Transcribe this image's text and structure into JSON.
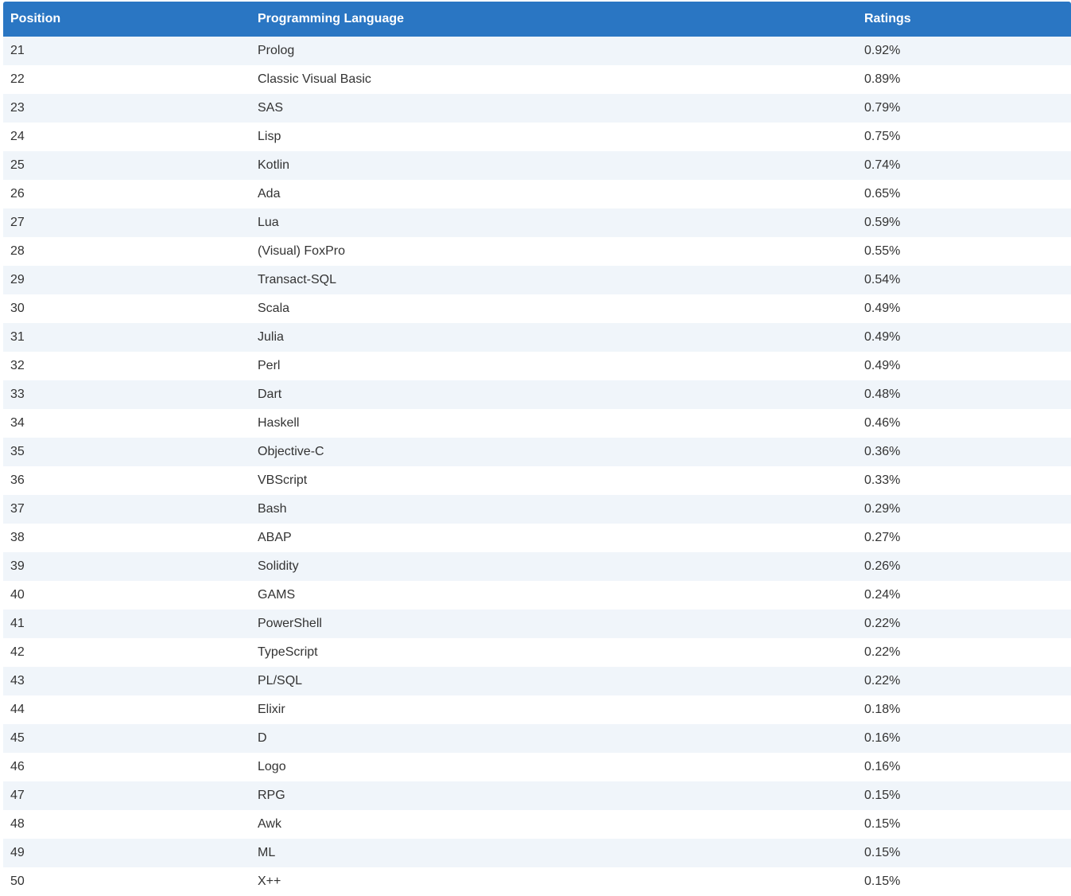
{
  "table": {
    "headers": {
      "position": "Position",
      "language": "Programming Language",
      "ratings": "Ratings"
    },
    "header_color": "#2a76c3",
    "stripe_color": "#f0f5fa",
    "rows": [
      {
        "position": "21",
        "language": "Prolog",
        "rating": "0.92%"
      },
      {
        "position": "22",
        "language": "Classic Visual Basic",
        "rating": "0.89%"
      },
      {
        "position": "23",
        "language": "SAS",
        "rating": "0.79%"
      },
      {
        "position": "24",
        "language": "Lisp",
        "rating": "0.75%"
      },
      {
        "position": "25",
        "language": "Kotlin",
        "rating": "0.74%"
      },
      {
        "position": "26",
        "language": "Ada",
        "rating": "0.65%"
      },
      {
        "position": "27",
        "language": "Lua",
        "rating": "0.59%"
      },
      {
        "position": "28",
        "language": "(Visual) FoxPro",
        "rating": "0.55%"
      },
      {
        "position": "29",
        "language": "Transact-SQL",
        "rating": "0.54%"
      },
      {
        "position": "30",
        "language": "Scala",
        "rating": "0.49%"
      },
      {
        "position": "31",
        "language": "Julia",
        "rating": "0.49%"
      },
      {
        "position": "32",
        "language": "Perl",
        "rating": "0.49%"
      },
      {
        "position": "33",
        "language": "Dart",
        "rating": "0.48%"
      },
      {
        "position": "34",
        "language": "Haskell",
        "rating": "0.46%"
      },
      {
        "position": "35",
        "language": "Objective-C",
        "rating": "0.36%"
      },
      {
        "position": "36",
        "language": "VBScript",
        "rating": "0.33%"
      },
      {
        "position": "37",
        "language": "Bash",
        "rating": "0.29%"
      },
      {
        "position": "38",
        "language": "ABAP",
        "rating": "0.27%"
      },
      {
        "position": "39",
        "language": "Solidity",
        "rating": "0.26%"
      },
      {
        "position": "40",
        "language": "GAMS",
        "rating": "0.24%"
      },
      {
        "position": "41",
        "language": "PowerShell",
        "rating": "0.22%"
      },
      {
        "position": "42",
        "language": "TypeScript",
        "rating": "0.22%"
      },
      {
        "position": "43",
        "language": "PL/SQL",
        "rating": "0.22%"
      },
      {
        "position": "44",
        "language": "Elixir",
        "rating": "0.18%"
      },
      {
        "position": "45",
        "language": "D",
        "rating": "0.16%"
      },
      {
        "position": "46",
        "language": "Logo",
        "rating": "0.16%"
      },
      {
        "position": "47",
        "language": "RPG",
        "rating": "0.15%"
      },
      {
        "position": "48",
        "language": "Awk",
        "rating": "0.15%"
      },
      {
        "position": "49",
        "language": "ML",
        "rating": "0.15%"
      },
      {
        "position": "50",
        "language": "X++",
        "rating": "0.15%"
      }
    ]
  }
}
